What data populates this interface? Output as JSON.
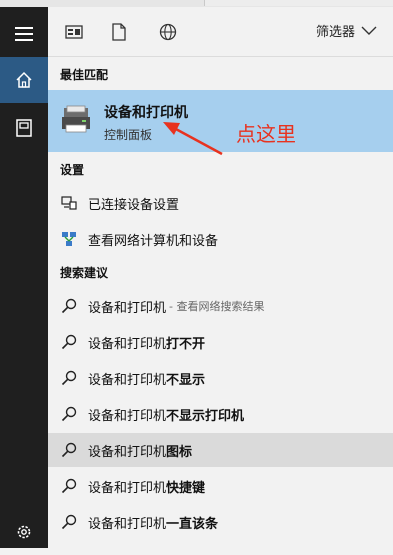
{
  "toolbar": {
    "filter_label": "筛选器"
  },
  "sections": {
    "best_match": "最佳匹配",
    "settings": "设置",
    "search_suggestions": "搜索建议"
  },
  "best_match": {
    "title": "设备和打印机",
    "subtitle": "控制面板"
  },
  "settings_items": [
    {
      "label": "已连接设备设置"
    },
    {
      "label": "查看网络计算机和设备"
    }
  ],
  "suggestions": [
    {
      "base": "设备和打印机",
      "suffix": "- 查看网络搜索结果"
    },
    {
      "base": "设备和打印机",
      "bold": "打不开"
    },
    {
      "base": "设备和打印机",
      "bold": "不显示"
    },
    {
      "base": "设备和打印机",
      "bold": "不显示打印机"
    },
    {
      "base": "设备和打印机",
      "bold": " 图标"
    },
    {
      "base": "设备和打印机",
      "bold": "快捷键"
    },
    {
      "base": "设备和打印机",
      "bold": "一直该条"
    }
  ],
  "annotation": {
    "text": "点这里",
    "color": "#e8321f"
  },
  "colors": {
    "sidebar": "#1f1f1f",
    "sidebar_active": "#2c5a85",
    "best_match_bg": "#a6cfee",
    "hover_row": "#dadada"
  }
}
